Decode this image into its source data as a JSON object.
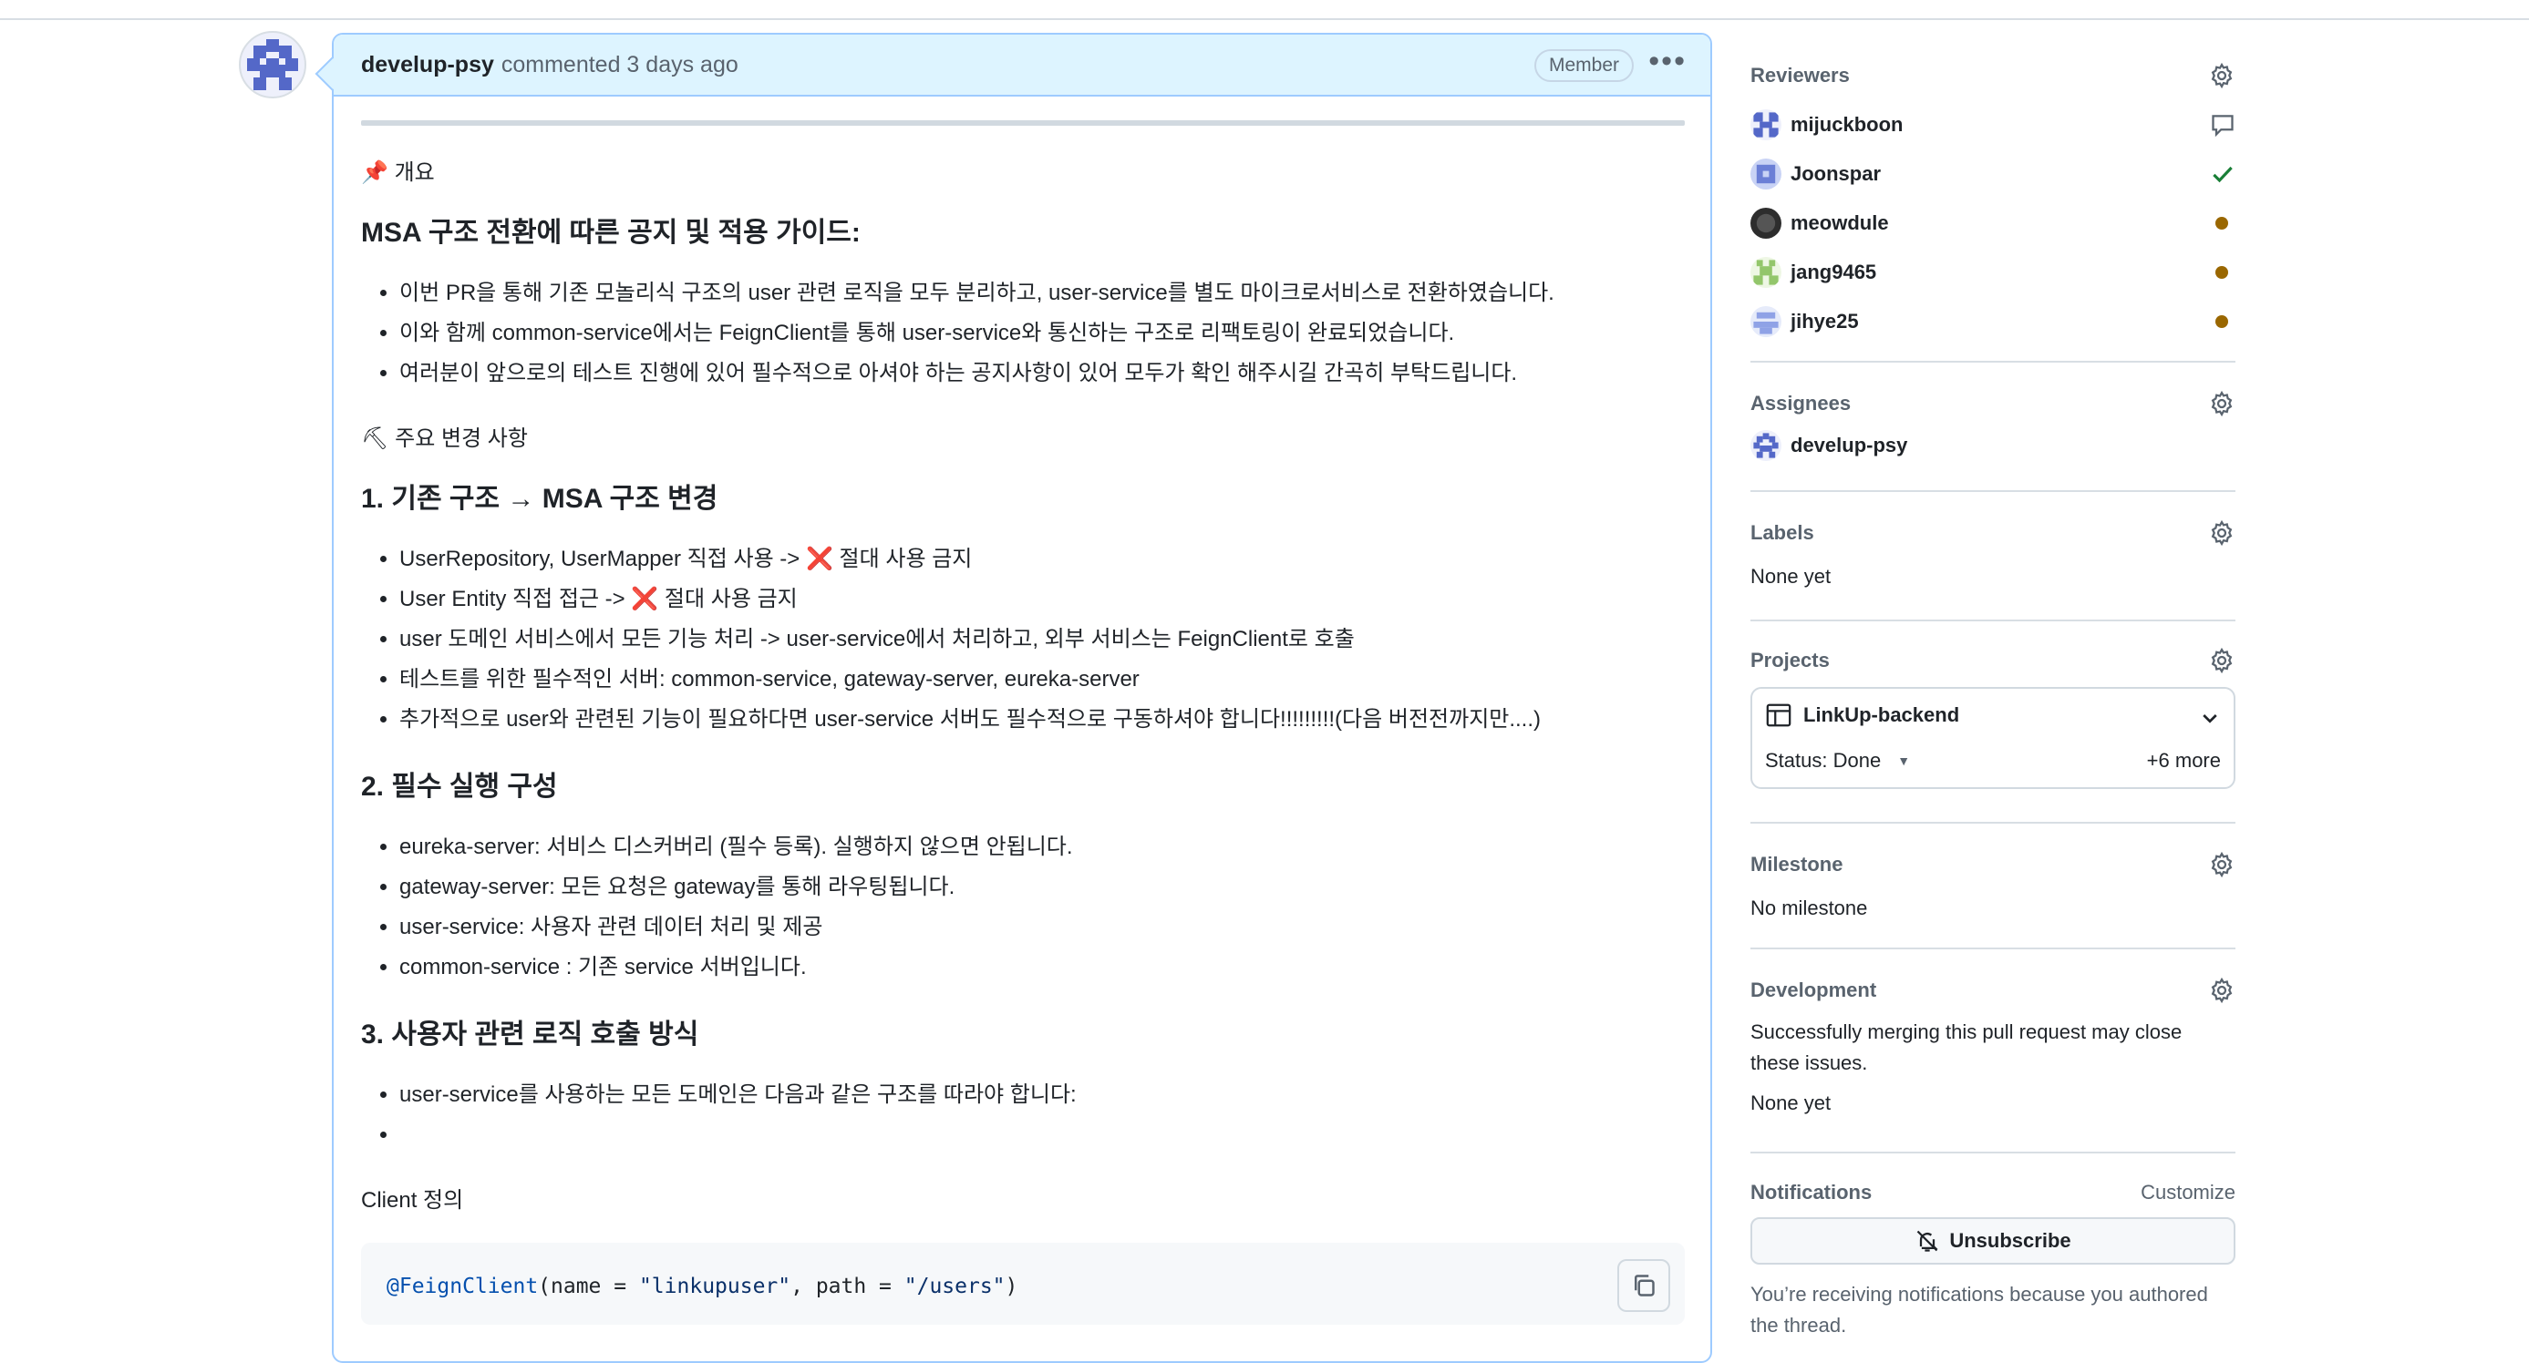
{
  "comment": {
    "author": "develup-psy",
    "meta": "commented 3 days ago",
    "badge": "Member",
    "more_icon": "kebab-horizontal-icon",
    "intro": "개요",
    "heading_main": "MSA 구조 전환에 따른 공지 및 적용 가이드:",
    "intro_items": [
      "이번 PR을 통해 기존 모놀리식 구조의 user 관련 로직을 모두 분리하고, user-service를 별도 마이크로서비스로 전환하였습니다.",
      "이와 함께 common-service에서는 FeignClient를 통해 user-service와 통신하는 구조로 리팩토링이 완료되었습니다.",
      "여러분이 앞으로의 테스트 진행에 있어 필수적으로 아셔야 하는 공지사항이 있어 모두가 확인 해주시길 간곡히 부탁드립니다."
    ],
    "changes_label": "주요 변경 사항",
    "section1": {
      "title": "1. 기존 구조 → MSA 구조 변경",
      "items": [
        {
          "pre": "UserRepository, UserMapper 직접 사용 -> ",
          "x": "❌",
          "post": " 절대 사용 금지"
        },
        {
          "pre": "User Entity 직접 접근 -> ",
          "x": "❌",
          "post": " 절대 사용 금지"
        },
        {
          "pre": "user 도메인 서비스에서 모든 기능 처리 -> user-service에서 처리하고, 외부 서비스는 FeignClient로 호출",
          "x": "",
          "post": ""
        },
        {
          "pre": "테스트를 위한 필수적인 서버: common-service, gateway-server, eureka-server",
          "x": "",
          "post": ""
        },
        {
          "pre": "추가적으로 user와 관련된 기능이 필요하다면 user-service 서버도 필수적으로 구동하셔야 합니다!!!!!!!!!(다음 버전전까지만....)",
          "x": "",
          "post": ""
        }
      ]
    },
    "section2": {
      "title": "2. 필수 실행 구성",
      "items": [
        "eureka-server: 서비스 디스커버리 (필수 등록). 실행하지 않으면 안됩니다.",
        "gateway-server: 모든 요청은 gateway를 통해 라우팅됩니다.",
        "user-service: 사용자 관련 데이터 처리 및 제공",
        "common-service : 기존 service 서버입니다."
      ]
    },
    "section3": {
      "title": "3. 사용자 관련 로직 호출 방식",
      "items": [
        "user-service를 사용하는 모든 도메인은 다음과 같은 구조를 따라야 합니다:",
        ""
      ]
    },
    "client_label": "Client 정의",
    "code": {
      "annotation": "@FeignClient",
      "p1": "(name = ",
      "s1": "\"linkupuser\"",
      "p2": ", path = ",
      "s2": "\"/users\"",
      "p3": ")"
    }
  },
  "sidebar": {
    "reviewers": {
      "title": "Reviewers",
      "items": [
        {
          "name": "mijuckboon",
          "status": "comment"
        },
        {
          "name": "Joonspar",
          "status": "approved"
        },
        {
          "name": "meowdule",
          "status": "pending"
        },
        {
          "name": "jang9465",
          "status": "pending"
        },
        {
          "name": "jihye25",
          "status": "pending"
        }
      ]
    },
    "assignees": {
      "title": "Assignees",
      "name": "develup-psy"
    },
    "labels": {
      "title": "Labels",
      "value": "None yet"
    },
    "projects": {
      "title": "Projects",
      "project_name": "LinkUp-backend",
      "status": "Status: Done",
      "more": "+6 more"
    },
    "milestone": {
      "title": "Milestone",
      "value": "No milestone"
    },
    "development": {
      "title": "Development",
      "text": "Successfully merging this pull request may close these issues.",
      "value": "None yet"
    },
    "notifications": {
      "title": "Notifications",
      "customize": "Customize",
      "button": "Unsubscribe",
      "note": "You’re receiving notifications because you authored the thread."
    }
  },
  "colors": {
    "header_bg": "#ddf4ff",
    "header_border": "#9ecbff",
    "approved": "#1a7f37",
    "pending": "#9a6700",
    "danger": "#d1242f"
  }
}
